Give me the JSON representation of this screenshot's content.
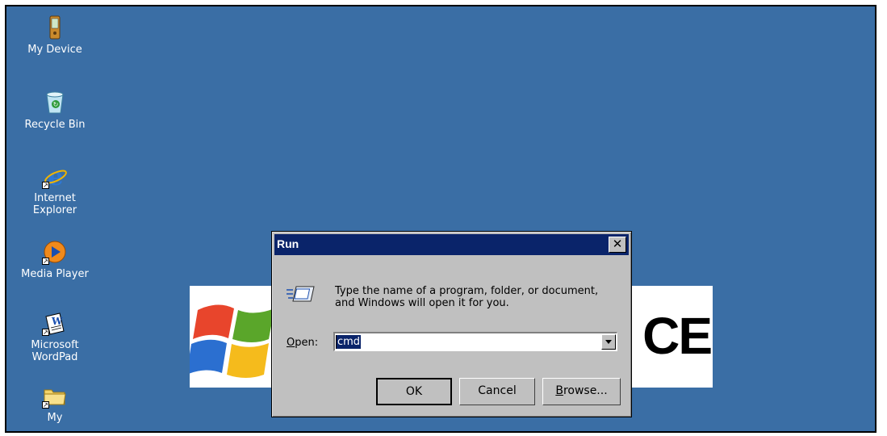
{
  "desktop": {
    "icons": [
      {
        "label": "My Device",
        "icon": "pda-device-icon"
      },
      {
        "label": "Recycle Bin",
        "icon": "recycle-bin-icon"
      },
      {
        "label": "Internet\nExplorer",
        "icon": "internet-explorer-icon"
      },
      {
        "label": "Media Player",
        "icon": "media-player-icon"
      },
      {
        "label": "Microsoft\nWordPad",
        "icon": "wordpad-icon"
      },
      {
        "label": "My",
        "icon": "folder-icon"
      }
    ],
    "background_color": "#3a6ea5"
  },
  "banner": {
    "text": "CE"
  },
  "run_dialog": {
    "title": "Run",
    "close_symbol": "✕",
    "prompt": "Type the name of a program, folder, or document, and Windows will open it for you.",
    "open_label": "pen:",
    "open_accel": "O",
    "input_value": "cmd",
    "ok_label": "OK",
    "cancel_label": "Cancel",
    "browse_accel": "B",
    "browse_label": "rowse...",
    "title_bar_color": "#0a246a"
  }
}
